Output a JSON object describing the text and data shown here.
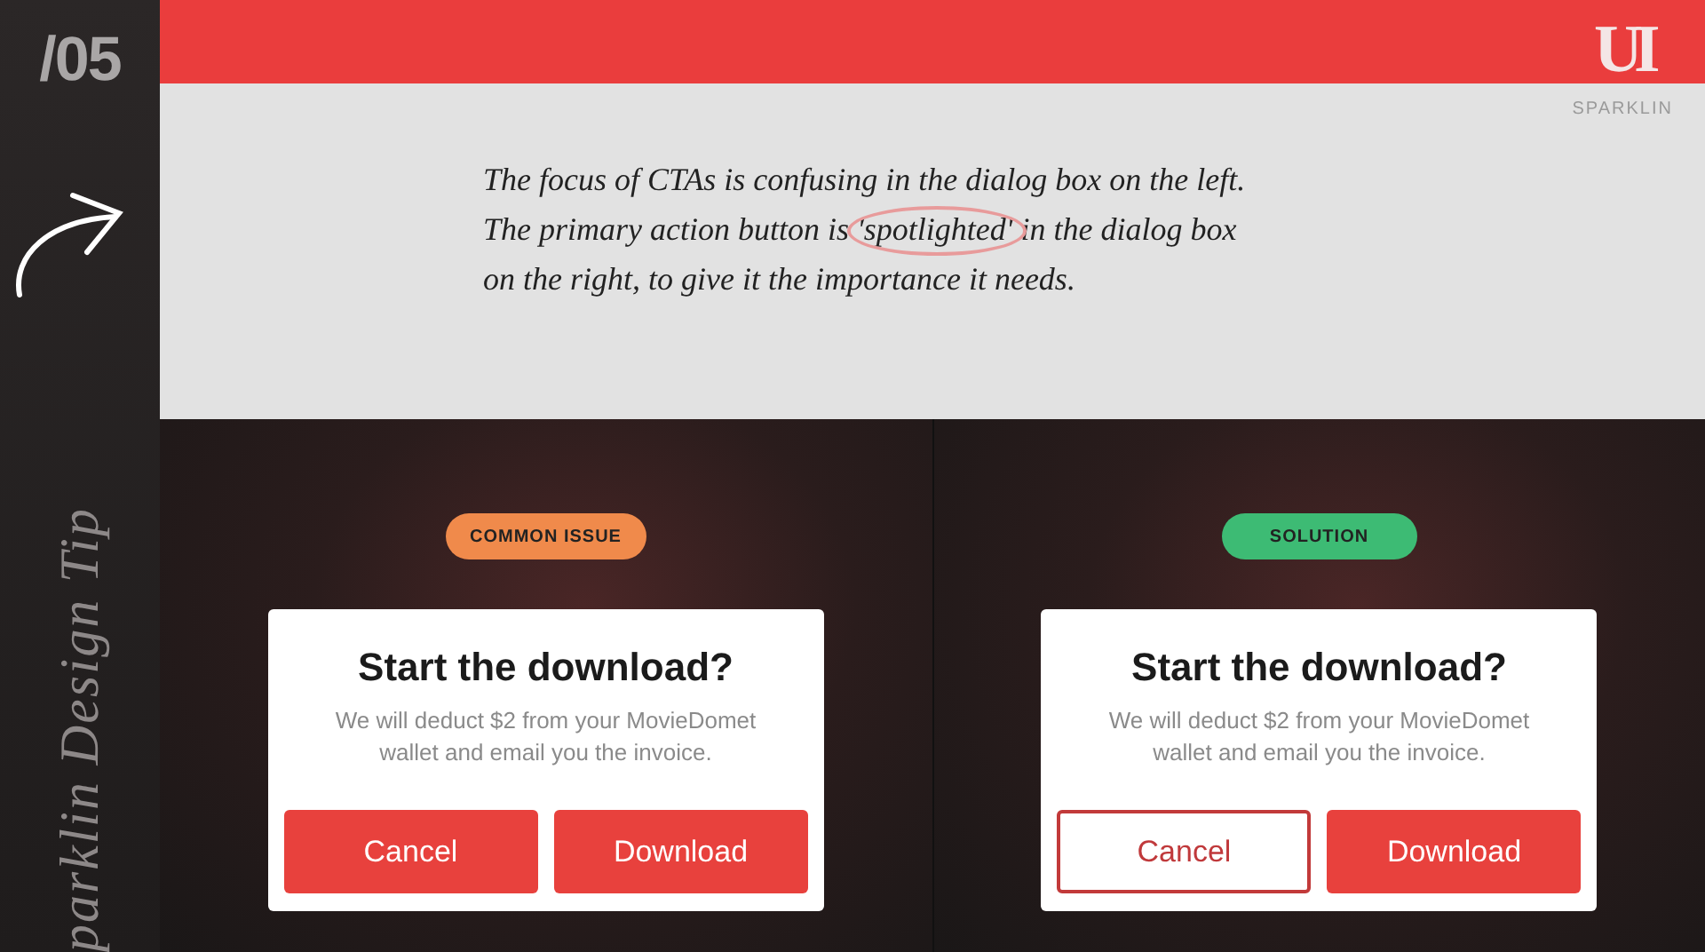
{
  "sidebar": {
    "number": "/05",
    "vertical_title": "parklin Design Tip"
  },
  "header": {
    "logo": "UI",
    "brand": "SPARKLIN"
  },
  "tip": {
    "text_before": "The focus of CTAs is confusing in the dialog box on the left.\nThe primary action button is ",
    "highlighted": "'spotlighted'",
    "text_after": " in the dialog box\non the right, to give it the importance it needs."
  },
  "panels": [
    {
      "badge": {
        "label": "COMMON ISSUE",
        "color": "#f08a4b"
      },
      "dialog": {
        "title": "Start the download?",
        "message": "We will deduct $2 from your MovieDomet wallet and email you the invoice.",
        "buttons": [
          {
            "label": "Cancel",
            "kind": "filled"
          },
          {
            "label": "Download",
            "kind": "filled"
          }
        ]
      }
    },
    {
      "badge": {
        "label": "SOLUTION",
        "color": "#3dbb74"
      },
      "dialog": {
        "title": "Start the download?",
        "message": "We will deduct $2 from your MovieDomet wallet and email you the invoice.",
        "buttons": [
          {
            "label": "Cancel",
            "kind": "outlined"
          },
          {
            "label": "Download",
            "kind": "filled"
          }
        ]
      }
    }
  ]
}
